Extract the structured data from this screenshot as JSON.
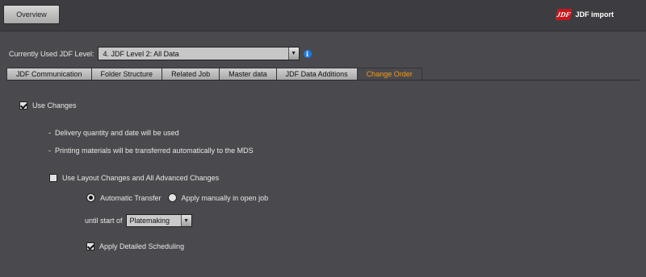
{
  "header": {
    "overview_label": "Overview",
    "brand_logo": "JDF",
    "brand_label": "JDF import"
  },
  "level": {
    "label": "Currently Used JDF Level:",
    "value": "4. JDF Level 2: All Data"
  },
  "tabs": [
    {
      "label": "JDF Communication"
    },
    {
      "label": "Folder Structure"
    },
    {
      "label": "Related Job"
    },
    {
      "label": "Master data"
    },
    {
      "label": "JDF Data Additions"
    },
    {
      "label": "Change Order"
    }
  ],
  "active_tab_color": "#f39a1e",
  "change_order": {
    "use_changes": {
      "label": "Use Changes",
      "checked": true
    },
    "notes": [
      "Delivery quantity and date will be used",
      "Printing materials will be transferred automatically to the MDS"
    ],
    "layout_changes": {
      "label": "Use Layout Changes and All Advanced Changes",
      "checked": false
    },
    "transfer": {
      "automatic_label": "Automatic Transfer",
      "manual_label": "Apply manually in open job",
      "selected": "automatic"
    },
    "until": {
      "label": "until start of",
      "value": "Platemaking"
    },
    "scheduling": {
      "label": "Apply Detailed Scheduling",
      "checked": true
    }
  }
}
